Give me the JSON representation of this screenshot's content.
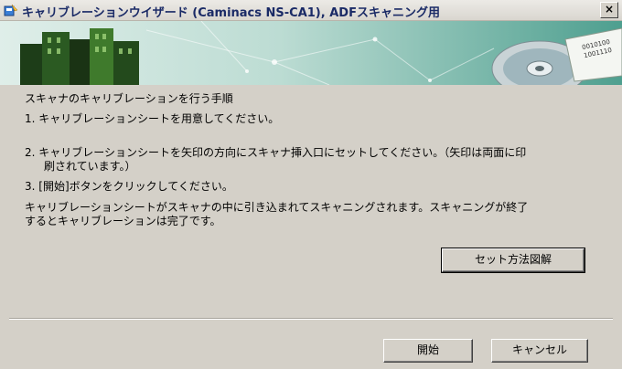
{
  "window": {
    "title": "キャリブレーションウイザード (Caminacs NS-CA1), ADFスキャニング用",
    "close_label": "×"
  },
  "banner": {
    "disc_text_1": "0010100",
    "disc_text_2": "1001110"
  },
  "instructions": {
    "heading": "スキャナのキャリブレーションを行う手順",
    "step1": "1.  キャリブレーションシートを用意してください。",
    "step2_line1": "2.  キャリブレーションシートを矢印の方向にスキャナ挿入口にセットしてください。（矢印は両面に印",
    "step2_line2": "刷されています。）",
    "step3": "3.  [開始]ボタンをクリックしてください。",
    "note_line1": "キャリブレーションシートがスキャナの中に引き込まれてスキャニングされます。スキャニングが終了",
    "note_line2": "するとキャリブレーションは完了です。"
  },
  "buttons": {
    "how_to_set": "セット方法図解",
    "start": "開始",
    "cancel": "キャンセル"
  }
}
